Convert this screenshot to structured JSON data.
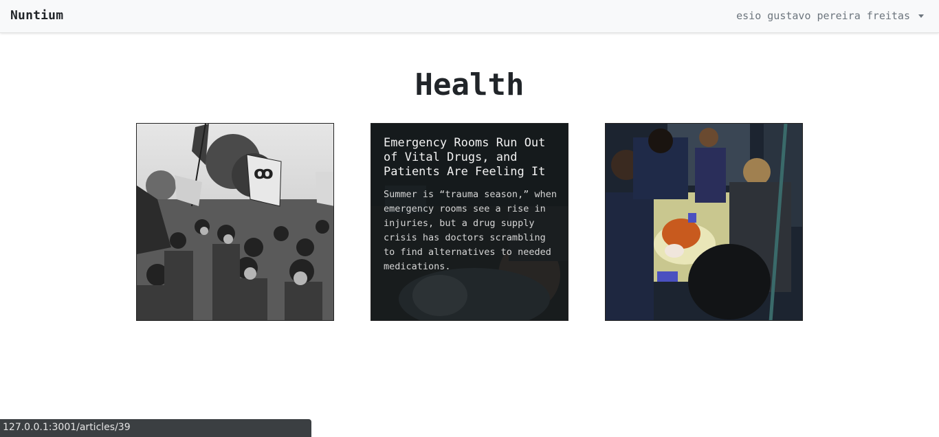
{
  "navbar": {
    "brand": "Nuntium",
    "user_name": "esio gustavo pereira freitas",
    "dropdown_icon": "caret-down-icon"
  },
  "page": {
    "title": "Health"
  },
  "articles": [
    {
      "image_desc": "protest-march-photo"
    },
    {
      "title": "Emergency Rooms Run Out of Vital Drugs, and Patients Are Feeling It",
      "summary": "Summer is “trauma season,” when emergency rooms see a rise in injuries, but a drug supply crisis has doctors scrambling to find alternatives to needed medications."
    },
    {
      "image_desc": "red-panda-veterinary-exam-photo"
    }
  ],
  "status_bar": {
    "url": "127.0.0.1:3001/articles/39"
  },
  "colors": {
    "navbar_bg": "#f8f9fa",
    "text": "#212529",
    "muted": "#6c757d",
    "status_bar_bg": "#3b3f42"
  }
}
